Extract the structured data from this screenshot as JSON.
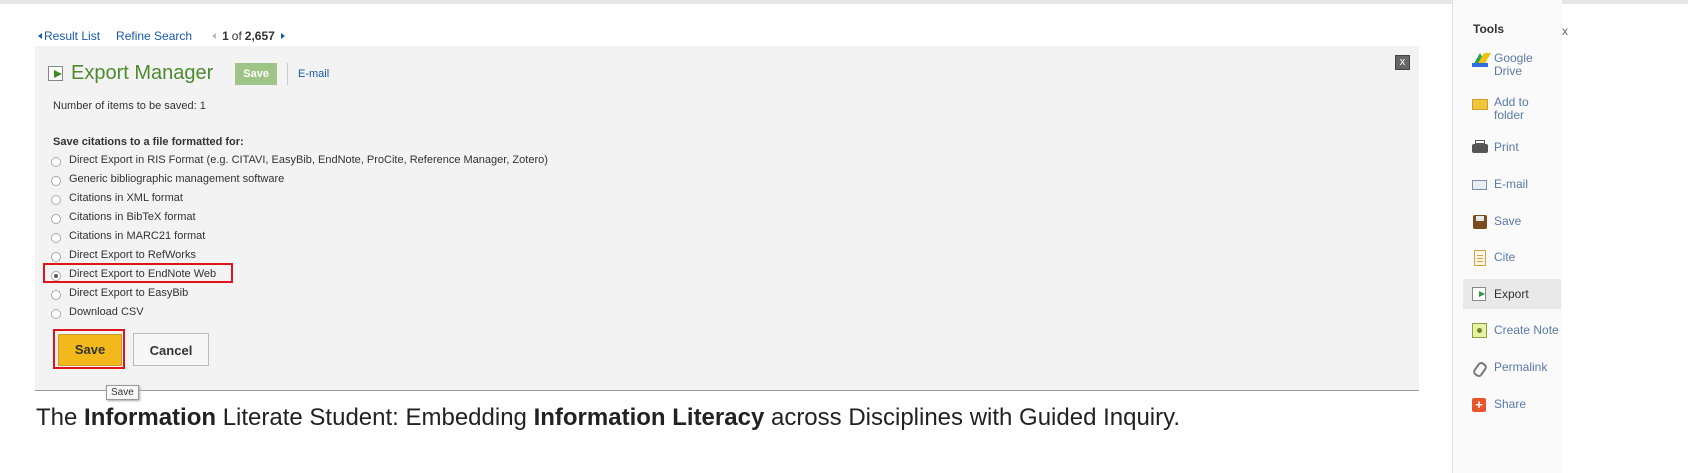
{
  "nav": {
    "result_list": "Result List",
    "refine_search": "Refine Search",
    "pager_current": "1",
    "pager_of": "of",
    "pager_total": "2,657"
  },
  "export_manager": {
    "title": "Export Manager",
    "save_tab": "Save",
    "email_tab": "E-mail",
    "close": "x",
    "count_text": "Number of items to be saved: 1",
    "format_heading": "Save citations to a file formatted for:",
    "options": [
      {
        "label": "Direct Export in RIS Format (e.g. CITAVI, EasyBib, EndNote, ProCite, Reference Manager, Zotero)",
        "selected": false
      },
      {
        "label": "Generic bibliographic management software",
        "selected": false
      },
      {
        "label": "Citations in XML format",
        "selected": false
      },
      {
        "label": "Citations in BibTeX format",
        "selected": false
      },
      {
        "label": "Citations in MARC21 format",
        "selected": false
      },
      {
        "label": "Direct Export to RefWorks",
        "selected": false
      },
      {
        "label": "Direct Export to EndNote Web",
        "selected": true
      },
      {
        "label": "Direct Export to EasyBib",
        "selected": false
      },
      {
        "label": "Download CSV",
        "selected": false
      }
    ],
    "save_button": "Save",
    "cancel_button": "Cancel",
    "tooltip": "Save"
  },
  "record_title": {
    "part1": "The ",
    "bold1": "Information",
    "part2": " Literate Student: Embedding ",
    "bold2": "Information Literacy",
    "part3": " across Disciplines with Guided Inquiry."
  },
  "tools": {
    "title": "Tools",
    "collapse": "x",
    "items": [
      {
        "label": "Google Drive",
        "icon": "google-drive-icon"
      },
      {
        "label": "Add to folder",
        "icon": "folder-icon"
      },
      {
        "label": "Print",
        "icon": "printer-icon"
      },
      {
        "label": "E-mail",
        "icon": "email-icon"
      },
      {
        "label": "Save",
        "icon": "save-disk-icon"
      },
      {
        "label": "Cite",
        "icon": "cite-document-icon"
      },
      {
        "label": "Export",
        "icon": "export-icon"
      },
      {
        "label": "Create Note",
        "icon": "note-icon"
      },
      {
        "label": "Permalink",
        "icon": "link-icon"
      },
      {
        "label": "Share",
        "icon": "share-icon"
      }
    ]
  },
  "colors": {
    "link_blue": "#1a5aa6",
    "title_green": "#4c8a2f",
    "save_yellow": "#f2b81c",
    "highlight_red": "#e0121a"
  }
}
